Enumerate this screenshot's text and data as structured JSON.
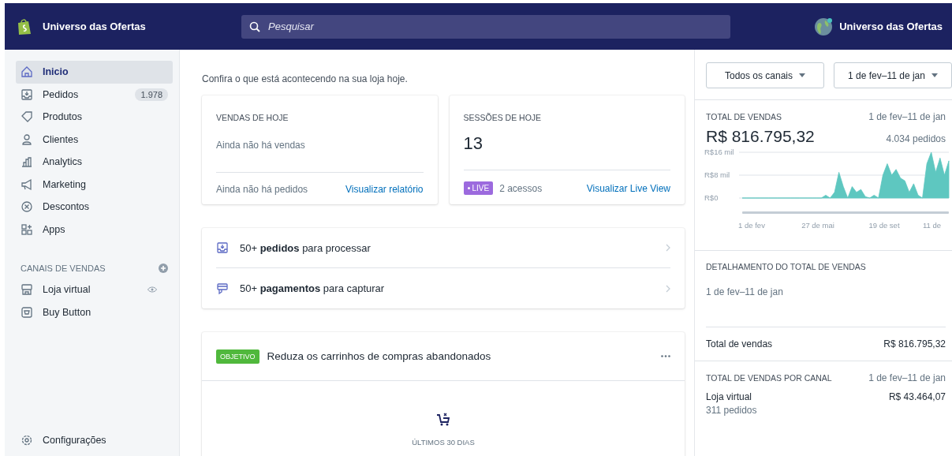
{
  "topbar": {
    "store_name": "Universo das Ofertas",
    "search": {
      "placeholder": "Pesquisar"
    },
    "account_name": "Universo das Ofertas"
  },
  "sidebar": {
    "items": [
      {
        "label": "Inicio",
        "kind": "home",
        "selected": true
      },
      {
        "label": "Pedidos",
        "kind": "orders",
        "badge": "1.978",
        "selected": false
      },
      {
        "label": "Produtos",
        "kind": "tag",
        "selected": false
      },
      {
        "label": "Clientes",
        "kind": "person",
        "selected": false
      },
      {
        "label": "Analytics",
        "kind": "chart",
        "selected": false
      },
      {
        "label": "Marketing",
        "kind": "megaphone",
        "selected": false
      },
      {
        "label": "Descontos",
        "kind": "discount",
        "selected": false
      },
      {
        "label": "Apps",
        "kind": "apps",
        "selected": false
      }
    ],
    "channels_title": "CANAIS DE VENDAS",
    "channels": [
      {
        "label": "Loja virtual",
        "kind": "store",
        "selected": false
      },
      {
        "label": "Buy Button",
        "kind": "buy",
        "selected": false
      }
    ],
    "settings": "Configurações"
  },
  "main": {
    "intro": "Confira o que está acontecendo na sua loja hoje.",
    "sales_card": {
      "title": "VENDAS DE HOJE",
      "message": "Ainda não há vendas",
      "footer_text": "Ainda não há pedidos",
      "link": "Visualizar relatório"
    },
    "sessions_card": {
      "title": "SESSÕES DE HOJE",
      "value": "13",
      "live_badge": "LIVE",
      "visits": "2 acessos",
      "link": "Visualizar Live View"
    },
    "tasks": [
      {
        "kind": "orders",
        "text": "50+ **pedidos** para processar"
      },
      {
        "kind": "payments",
        "text": "50+ **pagamentos** para capturar"
      }
    ],
    "goal_card": {
      "badge": "OBJETIVO",
      "title": "Reduza os carrinhos de compras abandonados",
      "period": "ÚLTIMOS 30 DIAS"
    }
  },
  "right_panel": {
    "filters": [
      "Todos os canais",
      "1 de fev–11 de jan"
    ],
    "total_sales": {
      "title": "TOTAL DE VENDAS",
      "range": "1 de fev–11 de jan",
      "amount": "R$ 816.795,32",
      "orders": "4.034 pedidos",
      "chart_y_labels": [
        "R$16 mil",
        "R$8 mil",
        "R$0"
      ],
      "chart_x_labels": [
        "1 de fev",
        "27 de mai",
        "19 de set",
        "11 de"
      ]
    },
    "breakdown": {
      "title": "DETALHAMENTO DO TOTAL DE VENDAS",
      "range": "1 de fev–11 de jan",
      "row_label": "Total de vendas",
      "row_value": "R$ 816.795,32"
    },
    "by_channel": {
      "title": "TOTAL DE VENDAS POR CANAL",
      "range": "1 de fev–11 de jan",
      "channel": "Loja virtual",
      "value": "R$ 43.464,07",
      "orders": "311 pedidos"
    }
  }
}
